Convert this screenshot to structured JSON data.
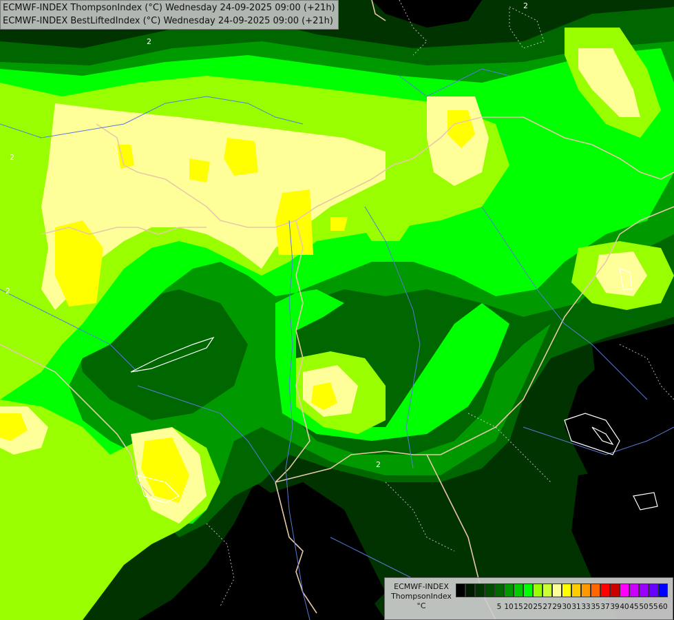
{
  "title": {
    "line1": "ECMWF-INDEX ThompsonIndex (°C) Wednesday 24-09-2025 09:00 (+21h)",
    "line2": "ECMWF-INDEX BestLiftedIndex (°C) Wednesday 24-09-2025 09:00 (+21h)"
  },
  "legend": {
    "model": "ECMWF-INDEX",
    "variable": "ThompsonIndex",
    "unit": "°C",
    "colors": [
      "#000000",
      "#001a00",
      "#003300",
      "#004d00",
      "#006600",
      "#009900",
      "#00cc00",
      "#00ff00",
      "#99ff00",
      "#ccff33",
      "#ffff99",
      "#ffff00",
      "#ffcc00",
      "#ff9900",
      "#ff6600",
      "#ff0000",
      "#cc0000",
      "#ff00ff",
      "#cc00ff",
      "#9900ff",
      "#6600ff",
      "#0000ff"
    ],
    "ticks": [
      "5",
      "10",
      "15",
      "20",
      "25",
      "27",
      "29",
      "30",
      "31",
      "33",
      "35",
      "37",
      "39",
      "40",
      "45",
      "50",
      "55",
      "60"
    ]
  },
  "map_colors": {
    "dark": "#003300",
    "deep": "#004d00",
    "mid": "#009900",
    "bright": "#00ff00",
    "lime": "#99ff00",
    "pale": "#ffff99",
    "yellow": "#ffff00",
    "border": "#e8c8a8",
    "river": "#5a7ad8",
    "contour": "#ffffff"
  },
  "contour_labels": [
    "2",
    "2",
    "2",
    "2",
    "2"
  ]
}
